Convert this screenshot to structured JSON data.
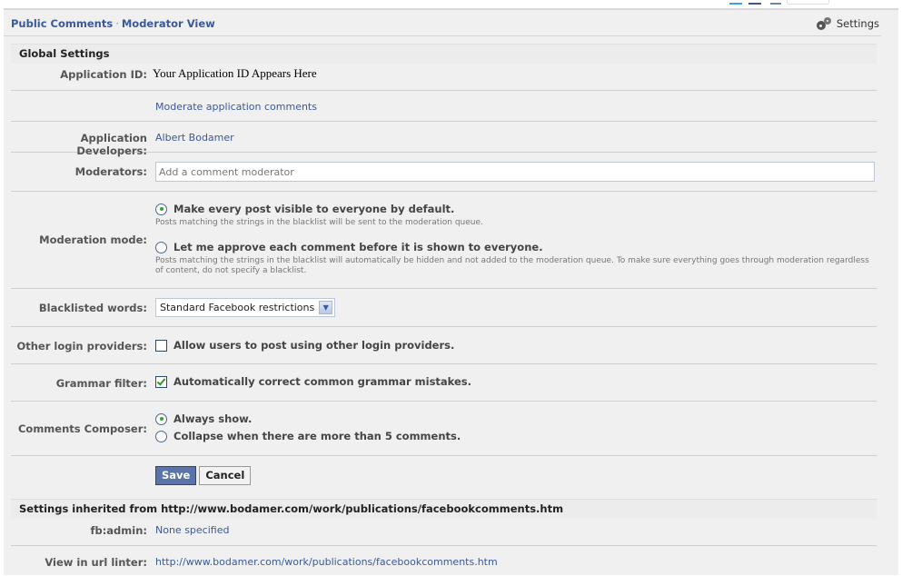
{
  "header": {
    "breadcrumb": [
      "Public Comments",
      "Moderator View"
    ],
    "breadcrumb_separator": "·",
    "settings_label": "Settings",
    "settings_icon": "gear-icon"
  },
  "global_settings": {
    "title": "Global Settings",
    "application_id": {
      "label": "Application ID:",
      "value": "Your Application ID Appears Here"
    },
    "moderate_link": "Moderate application comments",
    "developers": {
      "label": "Application Developers:",
      "value": "Albert Bodamer"
    },
    "moderators": {
      "label": "Moderators:",
      "placeholder": "Add a comment moderator",
      "value": ""
    },
    "moderation_mode": {
      "label": "Moderation mode:",
      "options": [
        {
          "label": "Make every post visible to everyone by default.",
          "help": "Posts matching the strings in the blacklist will be sent to the moderation queue.",
          "checked": true
        },
        {
          "label": "Let me approve each comment before it is shown to everyone.",
          "help": "Posts matching the strings in the blacklist will automatically be hidden and not added to the moderation queue. To make sure everything goes through moderation regardless of content, do not specify a blacklist.",
          "checked": false
        }
      ]
    },
    "blacklisted_words": {
      "label": "Blacklisted words:",
      "selected": "Standard Facebook restrictions"
    },
    "other_login": {
      "label": "Other login providers:",
      "option": "Allow users to post using other login providers.",
      "checked": false
    },
    "grammar_filter": {
      "label": "Grammar filter:",
      "option": "Automatically correct common grammar mistakes.",
      "checked": true
    },
    "comments_composer": {
      "label": "Comments Composer:",
      "options": [
        {
          "label": "Always show.",
          "checked": true
        },
        {
          "label": "Collapse when there are more than 5 comments.",
          "checked": false
        }
      ]
    },
    "save_label": "Save",
    "cancel_label": "Cancel"
  },
  "inherited": {
    "title": "Settings inherited from http://www.bodamer.com/work/publications/facebookcomments.htm",
    "fb_admin": {
      "label": "fb:admin:",
      "value": "None specified"
    },
    "url_linter": {
      "label": "View in url linter:",
      "value": "http://www.bodamer.com/work/publications/facebookcomments.htm"
    }
  },
  "colors": {
    "link": "#3b5998",
    "background": "#f0f0f0",
    "save_button": "#5b74a8",
    "check_green": "#21a121"
  }
}
